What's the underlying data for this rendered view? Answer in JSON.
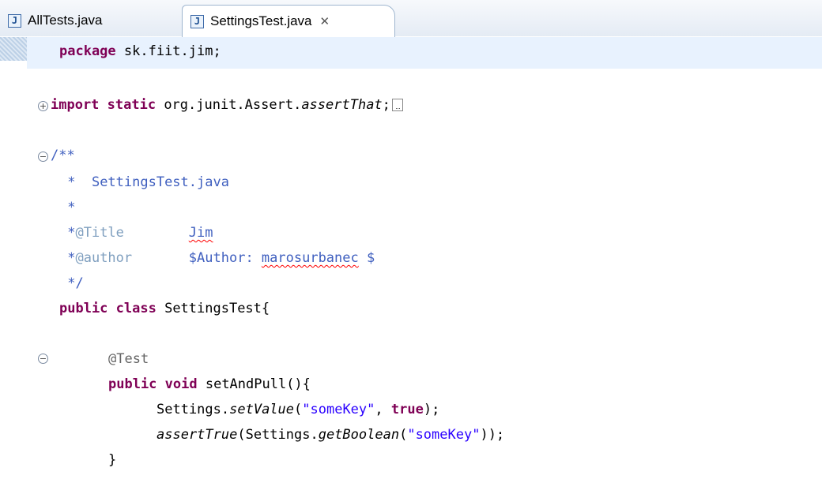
{
  "tabs": [
    {
      "label": "AllTests.java",
      "icon": "java-file-icon",
      "active": false
    },
    {
      "label": "SettingsTest.java",
      "icon": "java-file-icon",
      "active": true,
      "close_icon": "close-icon"
    }
  ],
  "code": {
    "package_kw": "package",
    "package_name": " sk.fiit.jim;",
    "import_kw": "import",
    "static_kw": " static",
    "import_path": " org.junit.Assert.",
    "import_method": "assertThat",
    "import_end": ";",
    "doc_open": "/**",
    "doc_line1_star": " *  ",
    "doc_line1_text": "SettingsTest.java",
    "doc_line2": " *",
    "doc_title_star": " *",
    "doc_title_tag": "@Title",
    "doc_title_pad": "        ",
    "doc_title_value": "Jim",
    "doc_author_star": " *",
    "doc_author_tag": "@author",
    "doc_author_pad": "       ",
    "doc_author_prefix": "$Author: ",
    "doc_author_name": "marosurbanec",
    "doc_author_suffix": " $",
    "doc_close": " */",
    "class_public": "public",
    "class_kw": " class",
    "class_name": " SettingsTest{",
    "annotation": "@Test",
    "method_public": "public",
    "method_void": " void",
    "method_name": " setAndPull(){",
    "set_obj": "Settings.",
    "set_method": "setValue",
    "set_open": "(",
    "set_str": "\"someKey\"",
    "set_comma": ", ",
    "set_true": "true",
    "set_close": ");",
    "assert_method": "assertTrue",
    "assert_open": "(Settings.",
    "assert_get": "getBoolean",
    "assert_paren": "(",
    "assert_str": "\"someKey\"",
    "assert_close": "));",
    "brace": "}"
  },
  "gutter": {
    "import_fold": "+",
    "doc_fold": "−",
    "method_fold": "−"
  },
  "colors": {
    "keyword": "#7f0055",
    "javadoc": "#3f5fbf",
    "javadoc_tag": "#7f9fbf",
    "string": "#2a00ff",
    "annotation": "#646464",
    "current_line": "#e8f2fe"
  }
}
